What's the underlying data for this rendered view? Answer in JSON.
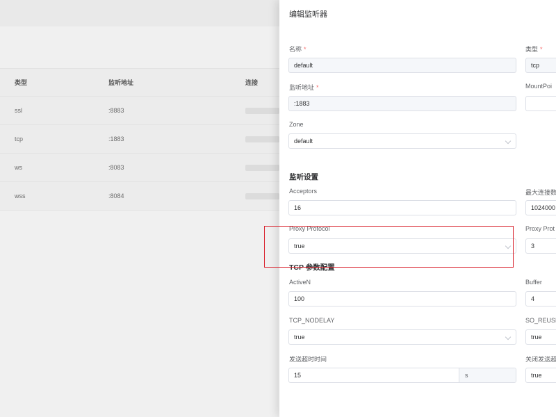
{
  "background": {
    "headers": [
      "类型",
      "监听地址",
      "连接"
    ],
    "rows": [
      {
        "type": "ssl",
        "address": ":8883"
      },
      {
        "type": "tcp",
        "address": ":1883"
      },
      {
        "type": "ws",
        "address": ":8083"
      },
      {
        "type": "wss",
        "address": ":8084"
      }
    ]
  },
  "drawer": {
    "title": "编辑监听器",
    "name": {
      "label": "名称",
      "value": "default"
    },
    "type": {
      "label": "类型",
      "value": "tcp"
    },
    "bind": {
      "label": "监听地址",
      "value": ":1883"
    },
    "mountpoint": {
      "label": "MountPoi",
      "value": ""
    },
    "zone": {
      "label": "Zone",
      "value": "default"
    },
    "listener_section": "监听设置",
    "acceptors": {
      "label": "Acceptors",
      "value": "16"
    },
    "max_conn": {
      "label": "最大连接数",
      "value": "1024000"
    },
    "proxy_protocol": {
      "label": "Proxy Protocol",
      "value": "true"
    },
    "proxy_protocol_timeout": {
      "label": "Proxy Prot",
      "value": "3"
    },
    "tcp_section": "TCP 参数配置",
    "active_n": {
      "label": "ActiveN",
      "value": "100"
    },
    "buffer": {
      "label": "Buffer",
      "value": "4"
    },
    "nodelay": {
      "label": "TCP_NODELAY",
      "value": "true"
    },
    "reuseaddr": {
      "label": "SO_REUSE",
      "value": "true"
    },
    "send_timeout": {
      "label": "发送超时时间",
      "value": "15",
      "unit": "s"
    },
    "send_timeout_close": {
      "label": "关闭发送超",
      "value": "true"
    }
  },
  "colors": {
    "required": "#f56c6c",
    "highlight": "#d9232e"
  }
}
